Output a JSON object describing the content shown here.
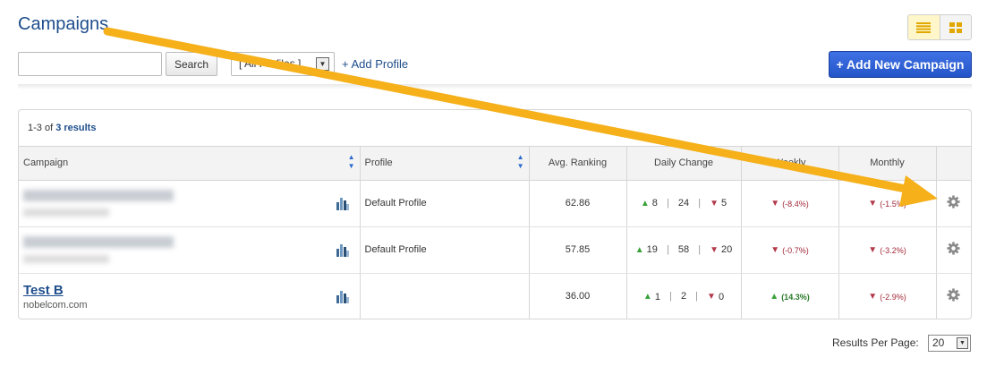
{
  "header": {
    "title": "Campaigns",
    "view_toggle": {
      "active": "list",
      "icons": [
        "list-view-icon",
        "grid-view-icon"
      ],
      "accent": "#f0b400"
    }
  },
  "toolbar": {
    "search_value": "",
    "search_button": "Search",
    "profile_select": "[ All Profiles ]",
    "add_profile": "+ Add Profile",
    "add_campaign": "+ Add New Campaign"
  },
  "table": {
    "summary": {
      "range": "1-3",
      "of": "of",
      "total": "3 results"
    },
    "columns": [
      "Campaign",
      "Profile",
      "Avg. Ranking",
      "Daily Change",
      "Weekly",
      "Monthly",
      ""
    ],
    "rows": [
      {
        "name": "",
        "domain": "",
        "blurred": true,
        "profile": "Default Profile",
        "avg_ranking": "62.86",
        "daily_up": "8",
        "daily_mid": "24",
        "daily_down": "5",
        "weekly": "(-8.4%)",
        "weekly_dir": "down",
        "monthly": "(-1.5%)",
        "monthly_dir": "down"
      },
      {
        "name": "",
        "domain": "",
        "blurred": true,
        "profile": "Default Profile",
        "avg_ranking": "57.85",
        "daily_up": "19",
        "daily_mid": "58",
        "daily_down": "20",
        "weekly": "(-0.7%)",
        "weekly_dir": "down",
        "monthly": "(-3.2%)",
        "monthly_dir": "down"
      },
      {
        "name": "Test B",
        "domain": "nobelcom.com",
        "blurred": false,
        "profile": "",
        "avg_ranking": "36.00",
        "daily_up": "1",
        "daily_mid": "2",
        "daily_down": "0",
        "weekly": "(14.3%)",
        "weekly_dir": "up",
        "monthly": "(-2.9%)",
        "monthly_dir": "down"
      }
    ]
  },
  "footer": {
    "results_per_page_label": "Results Per Page:",
    "results_per_page": "20"
  },
  "colors": {
    "title": "#1f4e8c",
    "button": "#2455c8",
    "up": "#3aa13a",
    "down": "#b33a4b",
    "annotation_arrow": "#f5b01a"
  }
}
